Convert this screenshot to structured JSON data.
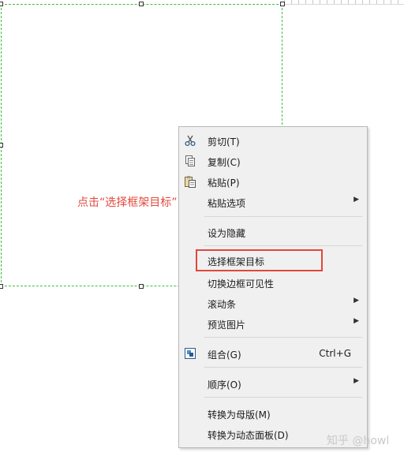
{
  "annotation": {
    "text": "点击“选择框架目标”"
  },
  "menu": {
    "items": [
      {
        "label": "剪切(T)",
        "icon": "scissors-icon"
      },
      {
        "label": "复制(C)",
        "icon": "copy-icon"
      },
      {
        "label": "粘贴(P)",
        "icon": "paste-icon"
      },
      {
        "label": "粘贴选项",
        "submenu": true
      },
      {
        "label": "设为隐藏"
      },
      {
        "label": "选择框架目标",
        "highlighted": true
      },
      {
        "label": "切换边框可见性"
      },
      {
        "label": "滚动条",
        "submenu": true
      },
      {
        "label": "预览图片",
        "submenu": true
      },
      {
        "label": "组合(G)",
        "shortcut": "Ctrl+G",
        "icon": "group-icon"
      },
      {
        "label": "顺序(O)",
        "submenu": true
      },
      {
        "label": "转换为母版(M)"
      },
      {
        "label": "转换为动态面板(D)"
      }
    ],
    "submenu_arrow": "▶"
  },
  "watermark": {
    "text": "知乎 @howl"
  },
  "colors": {
    "accent_red": "#e24b3f",
    "selection_green": "#3cbf3c",
    "menu_bg": "#f0f0f0"
  }
}
